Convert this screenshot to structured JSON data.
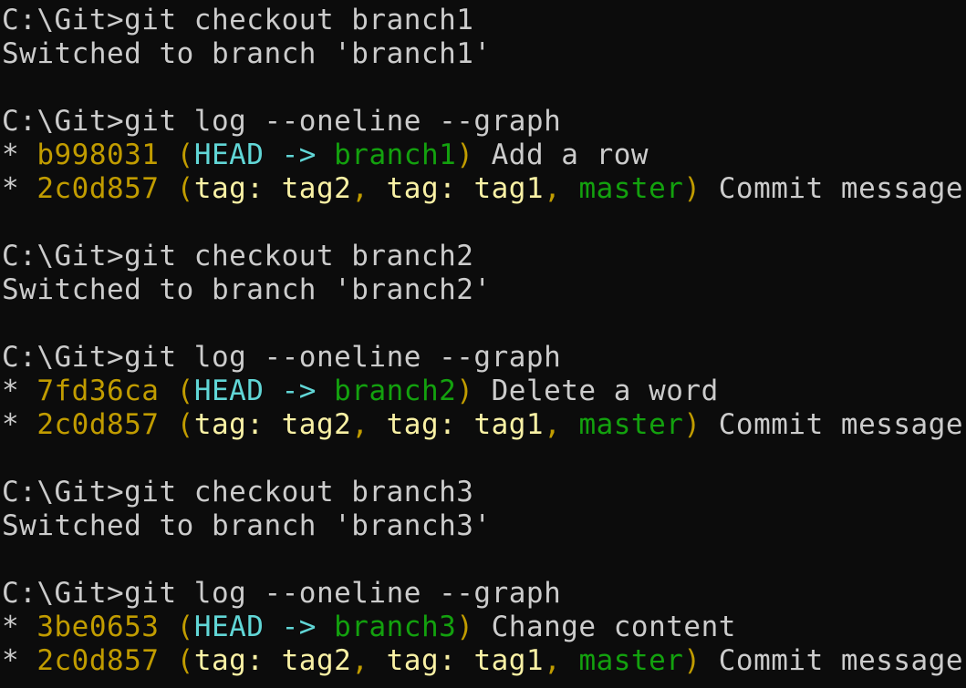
{
  "terminal": {
    "colors": {
      "background": "#0c0c0c",
      "foreground": "#cccccc",
      "yellow": "#c19c00",
      "cyan": "#61d6d6",
      "green": "#13a10e",
      "light_yellow": "#f9f1a5"
    },
    "lines": [
      {
        "segments": [
          {
            "text": "C:\\Git>git checkout branch1",
            "color": "default"
          }
        ]
      },
      {
        "segments": [
          {
            "text": "Switched to branch 'branch1'",
            "color": "default"
          }
        ]
      },
      {
        "segments": []
      },
      {
        "segments": [
          {
            "text": "C:\\Git>git log --oneline --graph",
            "color": "default"
          }
        ]
      },
      {
        "segments": [
          {
            "text": "* ",
            "color": "default"
          },
          {
            "text": "b998031",
            "color": "yellow"
          },
          {
            "text": " (",
            "color": "yellow"
          },
          {
            "text": "HEAD -> ",
            "color": "cyan"
          },
          {
            "text": "branch1",
            "color": "green"
          },
          {
            "text": ")",
            "color": "yellow"
          },
          {
            "text": " Add a row",
            "color": "default"
          }
        ]
      },
      {
        "segments": [
          {
            "text": "* ",
            "color": "default"
          },
          {
            "text": "2c0d857",
            "color": "yellow"
          },
          {
            "text": " (",
            "color": "yellow"
          },
          {
            "text": "tag: tag2",
            "color": "lightyellow"
          },
          {
            "text": ", ",
            "color": "yellow"
          },
          {
            "text": "tag: tag1",
            "color": "lightyellow"
          },
          {
            "text": ", ",
            "color": "yellow"
          },
          {
            "text": "master",
            "color": "green"
          },
          {
            "text": ")",
            "color": "yellow"
          },
          {
            "text": " Commit message",
            "color": "default"
          }
        ]
      },
      {
        "segments": []
      },
      {
        "segments": [
          {
            "text": "C:\\Git>git checkout branch2",
            "color": "default"
          }
        ]
      },
      {
        "segments": [
          {
            "text": "Switched to branch 'branch2'",
            "color": "default"
          }
        ]
      },
      {
        "segments": []
      },
      {
        "segments": [
          {
            "text": "C:\\Git>git log --oneline --graph",
            "color": "default"
          }
        ]
      },
      {
        "segments": [
          {
            "text": "* ",
            "color": "default"
          },
          {
            "text": "7fd36ca",
            "color": "yellow"
          },
          {
            "text": " (",
            "color": "yellow"
          },
          {
            "text": "HEAD -> ",
            "color": "cyan"
          },
          {
            "text": "branch2",
            "color": "green"
          },
          {
            "text": ")",
            "color": "yellow"
          },
          {
            "text": " Delete a word",
            "color": "default"
          }
        ]
      },
      {
        "segments": [
          {
            "text": "* ",
            "color": "default"
          },
          {
            "text": "2c0d857",
            "color": "yellow"
          },
          {
            "text": " (",
            "color": "yellow"
          },
          {
            "text": "tag: tag2",
            "color": "lightyellow"
          },
          {
            "text": ", ",
            "color": "yellow"
          },
          {
            "text": "tag: tag1",
            "color": "lightyellow"
          },
          {
            "text": ", ",
            "color": "yellow"
          },
          {
            "text": "master",
            "color": "green"
          },
          {
            "text": ")",
            "color": "yellow"
          },
          {
            "text": " Commit message",
            "color": "default"
          }
        ]
      },
      {
        "segments": []
      },
      {
        "segments": [
          {
            "text": "C:\\Git>git checkout branch3",
            "color": "default"
          }
        ]
      },
      {
        "segments": [
          {
            "text": "Switched to branch 'branch3'",
            "color": "default"
          }
        ]
      },
      {
        "segments": []
      },
      {
        "segments": [
          {
            "text": "C:\\Git>git log --oneline --graph",
            "color": "default"
          }
        ]
      },
      {
        "segments": [
          {
            "text": "* ",
            "color": "default"
          },
          {
            "text": "3be0653",
            "color": "yellow"
          },
          {
            "text": " (",
            "color": "yellow"
          },
          {
            "text": "HEAD -> ",
            "color": "cyan"
          },
          {
            "text": "branch3",
            "color": "green"
          },
          {
            "text": ")",
            "color": "yellow"
          },
          {
            "text": " Change content",
            "color": "default"
          }
        ]
      },
      {
        "segments": [
          {
            "text": "* ",
            "color": "default"
          },
          {
            "text": "2c0d857",
            "color": "yellow"
          },
          {
            "text": " (",
            "color": "yellow"
          },
          {
            "text": "tag: tag2",
            "color": "lightyellow"
          },
          {
            "text": ", ",
            "color": "yellow"
          },
          {
            "text": "tag: tag1",
            "color": "lightyellow"
          },
          {
            "text": ", ",
            "color": "yellow"
          },
          {
            "text": "master",
            "color": "green"
          },
          {
            "text": ")",
            "color": "yellow"
          },
          {
            "text": " Commit message",
            "color": "default"
          }
        ]
      }
    ]
  }
}
